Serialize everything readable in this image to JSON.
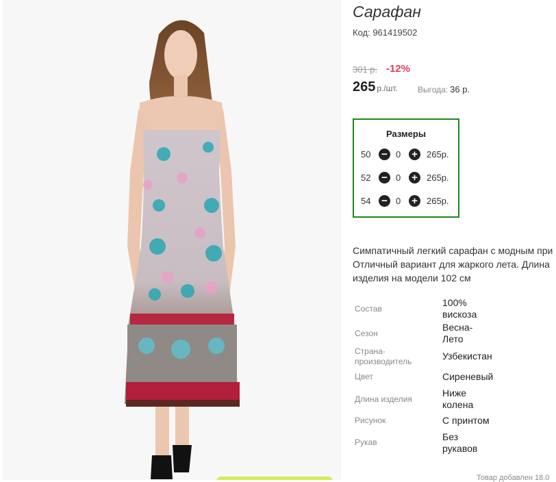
{
  "product": {
    "title": "Сарафан",
    "code": "Код: 961419502",
    "old_price": "301 р.",
    "discount": "-12%",
    "price": "265",
    "price_unit": "р./шт.",
    "benefit_label": "Выгода:",
    "benefit_value": "36 р."
  },
  "sizes": {
    "heading": "Размеры",
    "rows": [
      {
        "size": "50",
        "qty": "0",
        "price": "265р."
      },
      {
        "size": "52",
        "qty": "0",
        "price": "265р."
      },
      {
        "size": "54",
        "qty": "0",
        "price": "265р."
      }
    ]
  },
  "description": {
    "line1": "Симпатичный легкий сарафан с модным при",
    "line2": "Отличный вариант для жаркого лета. Длина",
    "line3": "изделия на модели 102 см"
  },
  "properties": [
    {
      "key_1": "Состав",
      "key_2": "",
      "val_1": "100%",
      "val_2": "вискоза"
    },
    {
      "key_1": "Сезон",
      "key_2": "",
      "val_1": "Весна-",
      "val_2": "Лето"
    },
    {
      "key_1": "Страна-",
      "key_2": "производитель",
      "val_1": "Узбекистан",
      "val_2": ""
    },
    {
      "key_1": "Цвет",
      "key_2": "",
      "val_1": "Сиреневый",
      "val_2": ""
    },
    {
      "key_1": "Длина изделия",
      "key_2": "",
      "val_1": "Ниже",
      "val_2": "колена"
    },
    {
      "key_1": "Рисунок",
      "key_2": "",
      "val_1": "С принтом",
      "val_2": ""
    },
    {
      "key_1": "Рукав",
      "key_2": "",
      "val_1": "Без",
      "val_2": "рукавов"
    }
  ],
  "footer": {
    "added": "Товар добавлен 18.0"
  },
  "icons": {
    "minus": "minus-circle-icon",
    "plus": "plus-circle-icon"
  },
  "colors": {
    "discount": "#e03c57",
    "sizes_border": "#1a8a1a",
    "add_button": "#d7ec5a"
  }
}
